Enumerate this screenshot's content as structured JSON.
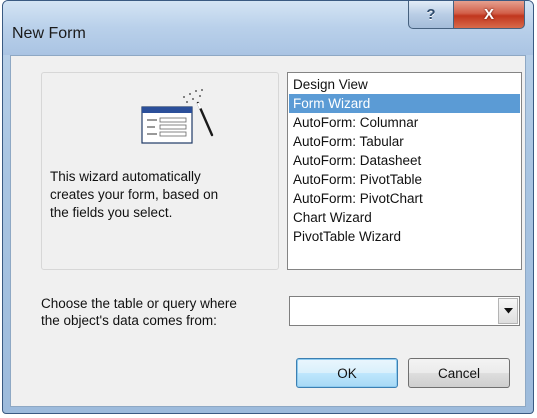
{
  "window": {
    "title": "New Form",
    "help_glyph": "?",
    "close_glyph": "X"
  },
  "preview": {
    "icon": "form-wizard-icon",
    "description_lines": [
      "This wizard automatically",
      "creates your form, based on",
      "the fields you select."
    ]
  },
  "list": {
    "items": [
      "Design View",
      "Form Wizard",
      "AutoForm: Columnar",
      "AutoForm: Tabular",
      "AutoForm: Datasheet",
      "AutoForm: PivotTable",
      "AutoForm: PivotChart",
      "Chart Wizard",
      "PivotTable Wizard"
    ],
    "selected": "Form Wizard"
  },
  "source": {
    "prompt_lines": [
      "Choose the table or query where",
      "the object's data comes from:"
    ],
    "value": ""
  },
  "buttons": {
    "ok": "OK",
    "cancel": "Cancel"
  },
  "colors": {
    "selection": "#5b9bd5",
    "close_button": "#c1361e",
    "frame": "#a9c5e2"
  }
}
